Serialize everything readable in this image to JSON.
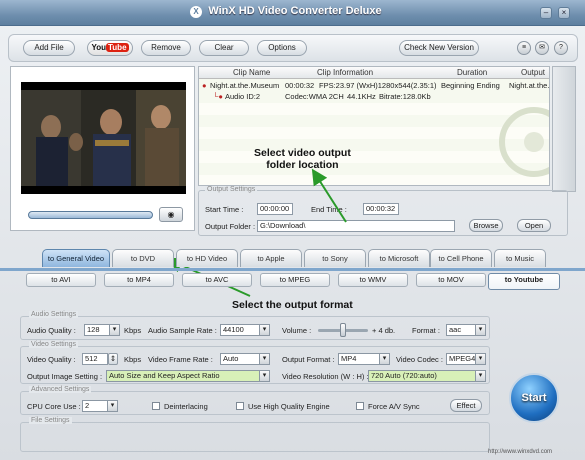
{
  "window": {
    "title": "WinX HD Video Converter Deluxe",
    "minimize": "–",
    "close": "×"
  },
  "toolbar": {
    "add_file": "Add File",
    "youtube_you": "You",
    "youtube_tube": "Tube",
    "remove": "Remove",
    "clear": "Clear",
    "options": "Options",
    "check_new_version": "Check New Version",
    "icons": [
      "settings-icon",
      "mail-icon",
      "help-icon"
    ]
  },
  "list": {
    "headers": [
      "Clip Name",
      "Clip Information",
      "Duration",
      "Output"
    ],
    "rows": [
      {
        "name": "Night.at.the.Museum",
        "duration": "00:00:32",
        "info": "FPS:23.97 (WxH)1280x544(2.35:1)",
        "range": "Beginning Ending",
        "output": "Night.at.the.M"
      },
      {
        "name": "Audio ID:2",
        "codec": "Codec:WMA 2CH",
        "rate": "44.1KHz",
        "bitrate": "Bitrate:128.0Kb"
      }
    ]
  },
  "output_settings": {
    "legend": "Output Settings",
    "start_label": "Start Time :",
    "start_value": "00:00:00",
    "end_label": "End Time :",
    "end_value": "00:00:32",
    "folder_label": "Output Folder :",
    "folder_value": "G:\\Download\\",
    "browse": "Browse",
    "open": "Open"
  },
  "tabs": [
    "to General Video",
    "to DVD",
    "to HD Video",
    "to Apple",
    "to Sony",
    "to Microsoft",
    "to Cell Phone",
    "to Music"
  ],
  "subtabs": [
    "to AVI",
    "to MP4",
    "to AVC",
    "to MPEG",
    "to WMV",
    "to MOV",
    "to Youtube"
  ],
  "annotations": {
    "folder": "Select video output\nfolder location",
    "format": "Select the output format"
  },
  "audio": {
    "legend": "Audio Settings",
    "quality_label": "Audio Quality :",
    "quality_value": "128",
    "kbps": "Kbps",
    "sample_label": "Audio Sample Rate :",
    "sample_value": "44100",
    "volume_label": "Volume :",
    "volume_value": "+ 4 db.",
    "format_label": "Format :",
    "format_value": "aac"
  },
  "video": {
    "legend": "Video Settings",
    "quality_label": "Video Quality :",
    "quality_value": "512",
    "kbps": "Kbps",
    "frame_label": "Video Frame Rate :",
    "frame_value": "Auto",
    "format_label": "Output Format :",
    "format_value": "MP4",
    "codec_label": "Video Codec :",
    "codec_value": "MPEG4",
    "image_label": "Output Image Setting :",
    "image_value": "Auto Size and Keep Aspect Ratio",
    "res_label": "Video Resolution (W : H) :",
    "res_value": "720 Auto (720:auto)"
  },
  "advanced": {
    "legend": "Advanced Settings",
    "cpu_label": "CPU Core Use :",
    "cpu_value": "2",
    "deinterlacing": "Deinterlacing",
    "hq_engine": "Use High Quality Engine",
    "force_av": "Force A/V Sync",
    "effect": "Effect"
  },
  "file_settings": {
    "legend": "File Settings"
  },
  "start_button": "Start",
  "footer_url": "http://www.winxdvd.com"
}
